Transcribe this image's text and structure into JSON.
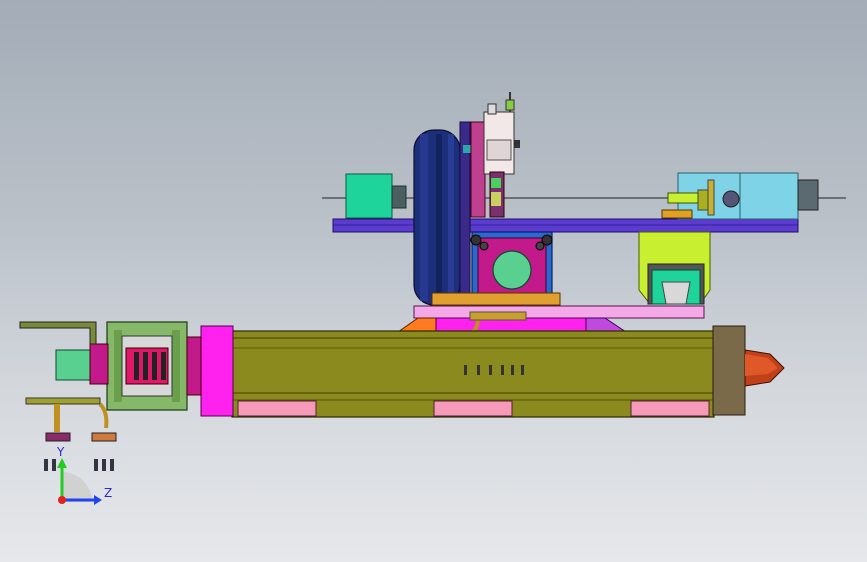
{
  "viewport": {
    "background_top": "#a3acb7",
    "background_bottom": "#e6e8eb"
  },
  "triad": {
    "y_label": "Y",
    "z_label": "Z",
    "y_color": "#22cc22",
    "z_color": "#2244ee",
    "origin_color": "#dd2222"
  },
  "colors": {
    "rail_olive": "#8a8a1e",
    "magenta": "#ff22ee",
    "pink_pads": "#f59ab8",
    "indigo_beam": "#5b3bd0",
    "wheel_navy": "#1d2e7a",
    "teal_motor": "#1fd49a",
    "cyan_box": "#7fd3e6",
    "lime_block": "#c8f030",
    "nose_cone": "#c0401a",
    "coupler_green": "#86b86a"
  }
}
